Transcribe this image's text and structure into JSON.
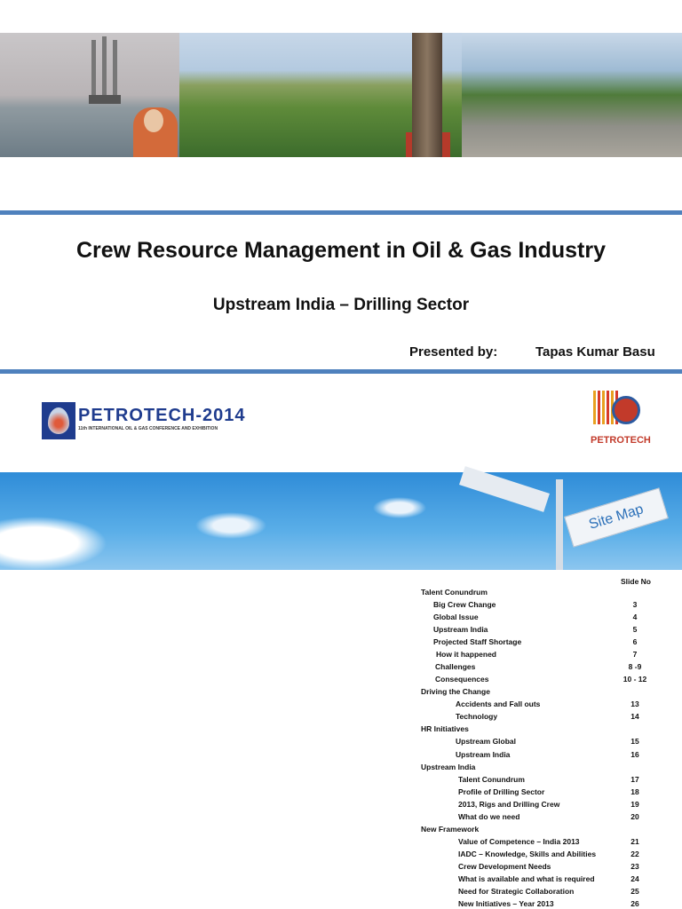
{
  "header": {
    "title": "Crew Resource Management in Oil & Gas Industry",
    "subtitle": "Upstream India – Drilling Sector",
    "presented_by_label": "Presented by:",
    "presenter": "Tapas Kumar Basu"
  },
  "logos": {
    "petrotech_2014": {
      "title": "PETROTECH-2014",
      "subtitle": "11th INTERNATIONAL OIL & GAS CONFERENCE AND EXHIBITION"
    },
    "petrotech": "PETROTECH"
  },
  "banner": {
    "sign_text": "Site Map"
  },
  "toc": {
    "header": "Slide No",
    "rows": [
      {
        "label": "Talent Conundrum",
        "slide": "",
        "level": 0
      },
      {
        "label": "Big Crew Change",
        "slide": "3",
        "level": 1
      },
      {
        "label": "Global Issue",
        "slide": "4",
        "level": 1
      },
      {
        "label": "Upstream India",
        "slide": "5",
        "level": 1
      },
      {
        "label": "Projected Staff Shortage",
        "slide": "6",
        "level": 1
      },
      {
        "label": "How it happened",
        "slide": "7",
        "level": 1
      },
      {
        "label": "Challenges",
        "slide": "8 -9",
        "level": 1
      },
      {
        "label": "Consequences",
        "slide": "10 - 12",
        "level": 1
      },
      {
        "label": "Driving the Change",
        "slide": "",
        "level": 0
      },
      {
        "label": "Accidents and Fall outs",
        "slide": "13",
        "level": 2
      },
      {
        "label": "Technology",
        "slide": "14",
        "level": 2
      },
      {
        "label": "HR Initiatives",
        "slide": "",
        "level": 0
      },
      {
        "label": "Upstream Global",
        "slide": "15",
        "level": 2
      },
      {
        "label": "Upstream India",
        "slide": "16",
        "level": 2
      },
      {
        "label": "Upstream India",
        "slide": "",
        "level": 0
      },
      {
        "label": "Talent Conundrum",
        "slide": "17",
        "level": 1
      },
      {
        "label": "Profile of Drilling Sector",
        "slide": "18",
        "level": 1
      },
      {
        "label": "2013, Rigs and Drilling Crew",
        "slide": "19",
        "level": 1
      },
      {
        "label": "What do we need",
        "slide": "20",
        "level": 1
      },
      {
        "label": "New Framework",
        "slide": "",
        "level": 0
      },
      {
        "label": "Value of Competence – India 2013",
        "slide": "21",
        "level": 1
      },
      {
        "label": "IADC – Knowledge, Skills and Abilities",
        "slide": "22",
        "level": 1
      },
      {
        "label": "Crew Development Needs",
        "slide": "23",
        "level": 1
      },
      {
        "label": "What is available and what is required",
        "slide": "24",
        "level": 1
      },
      {
        "label": "Need for Strategic Collaboration",
        "slide": "25",
        "level": 1
      },
      {
        "label": "New Initiatives – Year 2013",
        "slide": "26",
        "level": 1
      }
    ]
  }
}
